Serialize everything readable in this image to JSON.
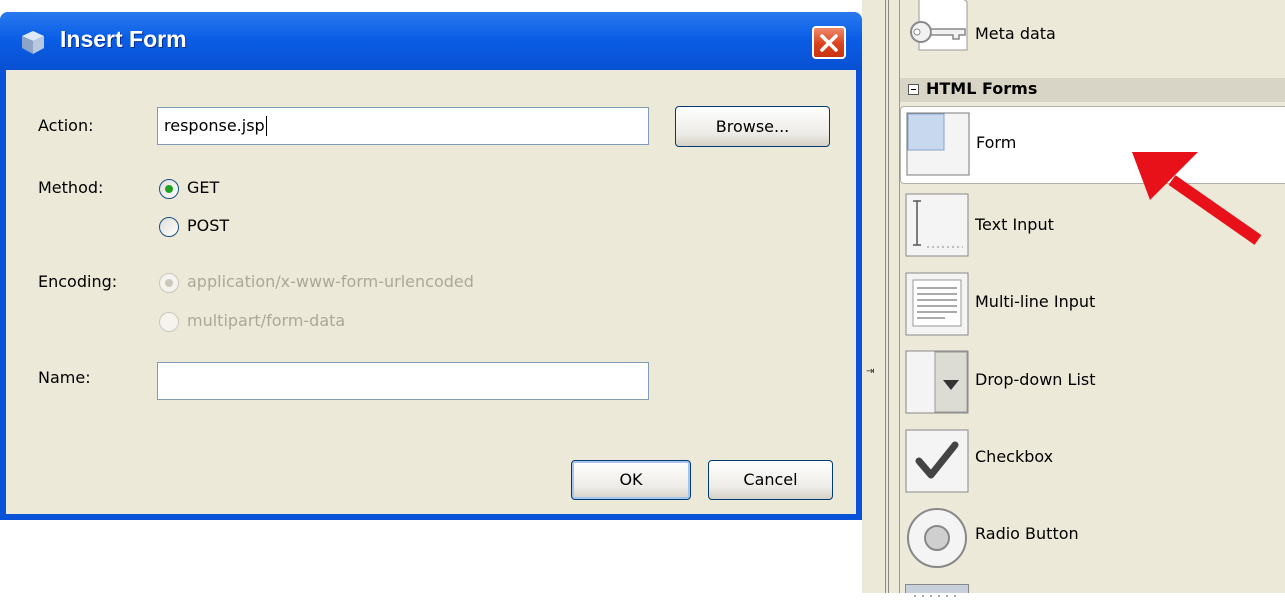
{
  "dialog": {
    "title": "Insert Form",
    "action_label": "Action:",
    "action_value": "response.jsp",
    "browse_label": "Browse...",
    "method_label": "Method:",
    "method_options": [
      "GET",
      "POST"
    ],
    "method_selected": "GET",
    "encoding_label": "Encoding:",
    "encoding_options": [
      "application/x-www-form-urlencoded",
      "multipart/form-data"
    ],
    "encoding_selected": "application/x-www-form-urlencoded",
    "name_label": "Name:",
    "name_value": "",
    "ok_label": "OK",
    "cancel_label": "Cancel"
  },
  "palette": {
    "items_top": [
      {
        "label": "Meta data",
        "icon": "key-icon"
      }
    ],
    "category": {
      "label": "HTML Forms",
      "expanded": true
    },
    "items": [
      {
        "label": "Form",
        "icon": "form-icon",
        "selected": true
      },
      {
        "label": "Text Input",
        "icon": "text-input-icon"
      },
      {
        "label": "Multi-line Input",
        "icon": "multiline-input-icon"
      },
      {
        "label": "Drop-down List",
        "icon": "dropdown-list-icon"
      },
      {
        "label": "Checkbox",
        "icon": "checkbox-icon"
      },
      {
        "label": "Radio Button",
        "icon": "radio-button-icon"
      }
    ]
  },
  "colors": {
    "titlebar": "#0b5ee6",
    "dialog_bg": "#ece9d8",
    "annotation_arrow": "#e8111a",
    "radio_selected": "#21a121"
  }
}
